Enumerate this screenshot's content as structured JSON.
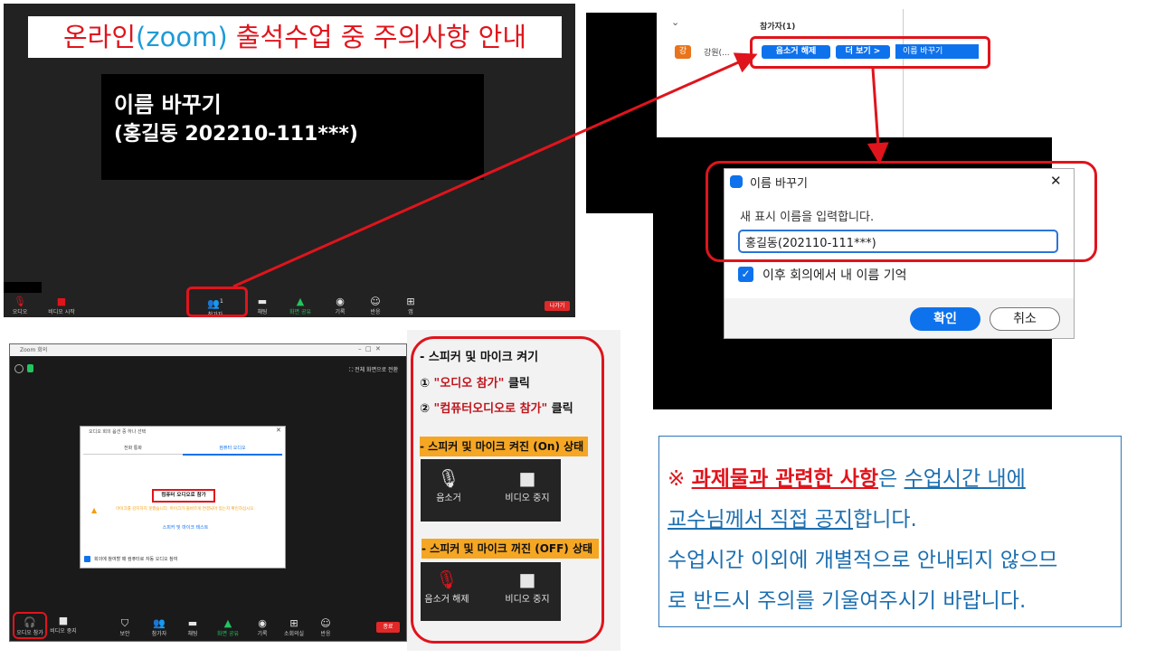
{
  "title": {
    "part1": "온라인",
    "zoom": "(zoom)",
    "part2": " 출석수업 중 주의사항 안내"
  },
  "rename_note": {
    "line1": "이름 바꾸기",
    "line2": "(홍길동 202210-111***)"
  },
  "toolbar": {
    "audio": "오디오",
    "video_start": "비디오 시작",
    "participants": "참가자",
    "participant_count": "1",
    "chat": "채팅",
    "share_screen": "화면 공유",
    "record": "기록",
    "reactions": "반응",
    "apps": "앱",
    "leave": "나가기"
  },
  "participants_panel": {
    "header": "참가자(1)",
    "avatar_letter": "강",
    "name": "강원(...",
    "unmute_btn": "음소거 해제",
    "more_btn": "더 보기 >",
    "rename_menu_item": "이름 바꾸기",
    "chevron": "⌄"
  },
  "rename_dialog": {
    "title": "이름 바꾸기",
    "prompt": "새 표시 이름을 입력합니다.",
    "input_value": "홍길동(202110-111***)",
    "remember_label": "이후 회의에서 내 이름 기억",
    "confirm": "확인",
    "cancel": "취소",
    "close": "✕"
  },
  "zoom_window": {
    "title": "Zoom 회의",
    "fullscreen": "전체 화면으로 전환",
    "audio_dialog": {
      "title": "오디오 회의 옵션 중 하나 선택",
      "tab_phone": "전화 통화",
      "tab_computer": "컴퓨터 오디오",
      "join_btn": "컴퓨터 오디오로 참가",
      "warning": "마이크를 감지하지 못했습니다. 마이크가 올바르게 연결되어 있는지 확인하십시오.",
      "test_link": "스피커 및 마이크 테스트",
      "auto_join": "회의에 참여할 때 컴퓨터로 자동 오디오 참여"
    },
    "toolbar": {
      "join_audio": "오디오 참가",
      "stop_video": "비디오 중지",
      "security": "보안",
      "participants": "참가자",
      "chat": "채팅",
      "share_screen": "화면 공유",
      "record": "기록",
      "breakout": "소회의실",
      "reactions": "반응",
      "end": "종료"
    }
  },
  "instructions": {
    "heading": "- 스피커 및 마이크 켜기",
    "step1_num": "①",
    "step1_quoted": "\"오디오 참가\"",
    "step1_rest": " 클릭",
    "step2_num": "②",
    "step2_quoted": "\"컴퓨터오디오로 참가\"",
    "step2_rest": " 클릭",
    "on_label": "- 스피커 및 마이크 켜진 (On) 상태",
    "on_mute": "음소거",
    "on_video": "비디오 중지",
    "off_label": "- 스피커 및 마이크 꺼진 (OFF) 상태",
    "off_unmute": "음소거 해제",
    "off_video": "비디오 중지"
  },
  "notice": {
    "mark": "※ ",
    "red_underlined": "과제물과 관련한 사항",
    "t1": "은 ",
    "u1": "수업시간 내에",
    "u2": "교수님께서 직접 공지",
    "t2": "합니다.",
    "line3": "수업시간 이외에 개별적으로 안내되지 않으므",
    "line4": "로 반드시 주의를 기울여주시기 바랍니다."
  },
  "colors": {
    "annotation_red": "#e0141c",
    "zoom_blue": "#0e72ed",
    "dark_bg": "#222222",
    "label_orange": "#f5a623",
    "notice_blue": "#1d6fb0"
  }
}
